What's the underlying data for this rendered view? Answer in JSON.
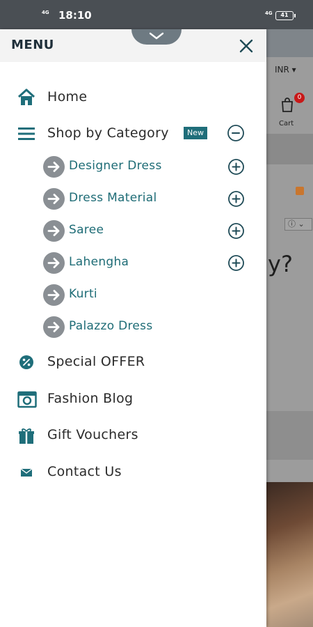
{
  "status_bar": {
    "network_left": "4G",
    "time": "18:10",
    "network_right": "4G",
    "battery": "41"
  },
  "background_page": {
    "currency": "INR ▾",
    "cart_count": "0",
    "cart_label": "Cart",
    "info_select": "ⓘ ⌄",
    "partial_text": "y?"
  },
  "drawer": {
    "title": "MENU",
    "items": [
      {
        "label": "Home",
        "icon": "home-icon"
      },
      {
        "label": "Shop by Category",
        "icon": "hamburger-icon",
        "badge": "New"
      },
      {
        "label": "Special OFFER",
        "icon": "percent-icon"
      },
      {
        "label": "Fashion Blog",
        "icon": "camera-icon"
      },
      {
        "label": "Gift Vouchers",
        "icon": "gift-icon"
      },
      {
        "label": "Contact Us",
        "icon": "envelope-icon"
      }
    ],
    "categories": [
      {
        "label": "Designer Dress",
        "expandable": true
      },
      {
        "label": "Dress Material",
        "expandable": true
      },
      {
        "label": "Saree",
        "expandable": true
      },
      {
        "label": "Lahengha",
        "expandable": true
      },
      {
        "label": "Kurti",
        "expandable": false
      },
      {
        "label": "Palazzo Dress",
        "expandable": false
      }
    ]
  },
  "colors": {
    "accent": "#1f6e7a",
    "header_bg": "#f3f3f3",
    "badge_bg": "#1f6e7a",
    "cart_badge": "#c81818"
  }
}
